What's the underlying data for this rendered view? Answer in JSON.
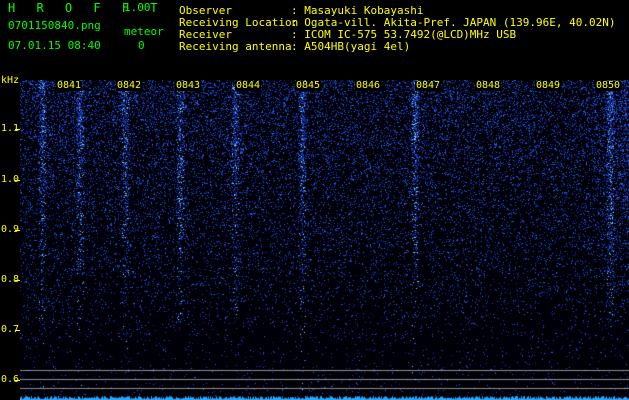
{
  "header": {
    "app_title": "H R O F F T",
    "version": "1.00",
    "filename": "0701150840.png",
    "meteor_label": "meteor",
    "meteor_count": "0",
    "datetime": "07.01.15 08:40",
    "fields": [
      {
        "label": "Observer",
        "value": ": Masayuki Kobayashi"
      },
      {
        "label": "Receiving Location",
        "value": ": Ogata-vill. Akita-Pref. JAPAN (139.96E, 40.02N)"
      },
      {
        "label": "Receiver",
        "value": ": ICOM IC-575 53.7492(@LCD)MHz USB"
      },
      {
        "label": "Receiving antenna",
        "value": ": A504HB(yagi 4el)"
      }
    ]
  },
  "spectrogram": {
    "freq_unit": "kHz",
    "freq_ticks": [
      "1.1",
      "1.0",
      "0.9",
      "0.8",
      "0.7",
      "0.6"
    ],
    "time_labels": [
      "0841",
      "0842",
      "0843",
      "0844",
      "0845",
      "0846",
      "0847",
      "0848",
      "0849",
      "0850"
    ],
    "colors": {
      "background": "#000000",
      "noise": "#1a2aa8",
      "signal": "#7fd0ff",
      "label": "#ffff00",
      "text": "#00ff00"
    }
  }
}
